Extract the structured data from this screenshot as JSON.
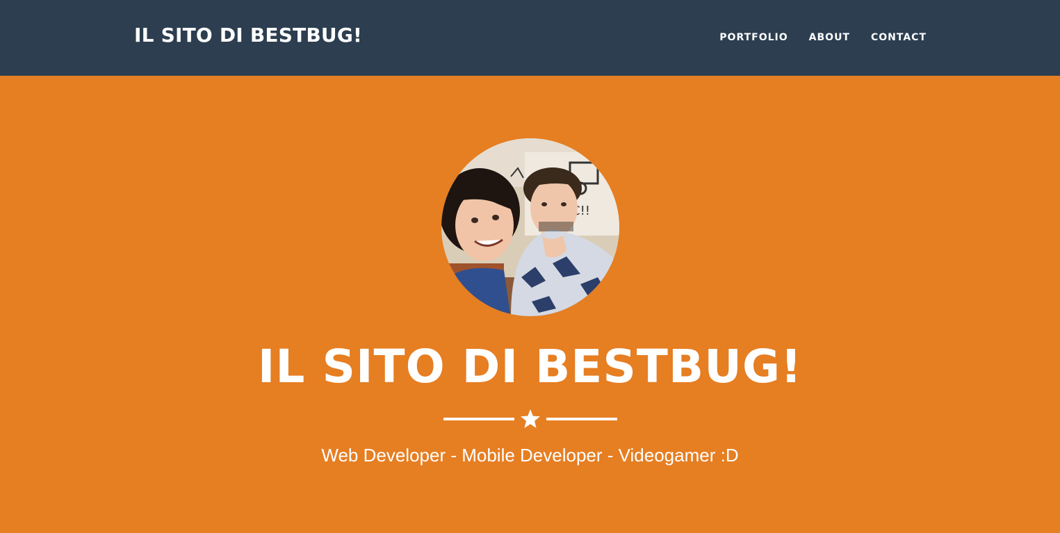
{
  "navbar": {
    "brand": "IL SITO DI BESTBUG!",
    "links": [
      {
        "label": "PORTFOLIO"
      },
      {
        "label": "ABOUT"
      },
      {
        "label": "CONTACT"
      }
    ]
  },
  "hero": {
    "title": "IL SITO DI BESTBUG!",
    "skills": "Web Developer - Mobile Developer - Videogamer :D",
    "avatar_icon": "profile-photo",
    "divider_icon": "star-icon"
  },
  "colors": {
    "navbar_bg": "#2c3e50",
    "hero_bg": "#e67e22",
    "text": "#ffffff"
  }
}
